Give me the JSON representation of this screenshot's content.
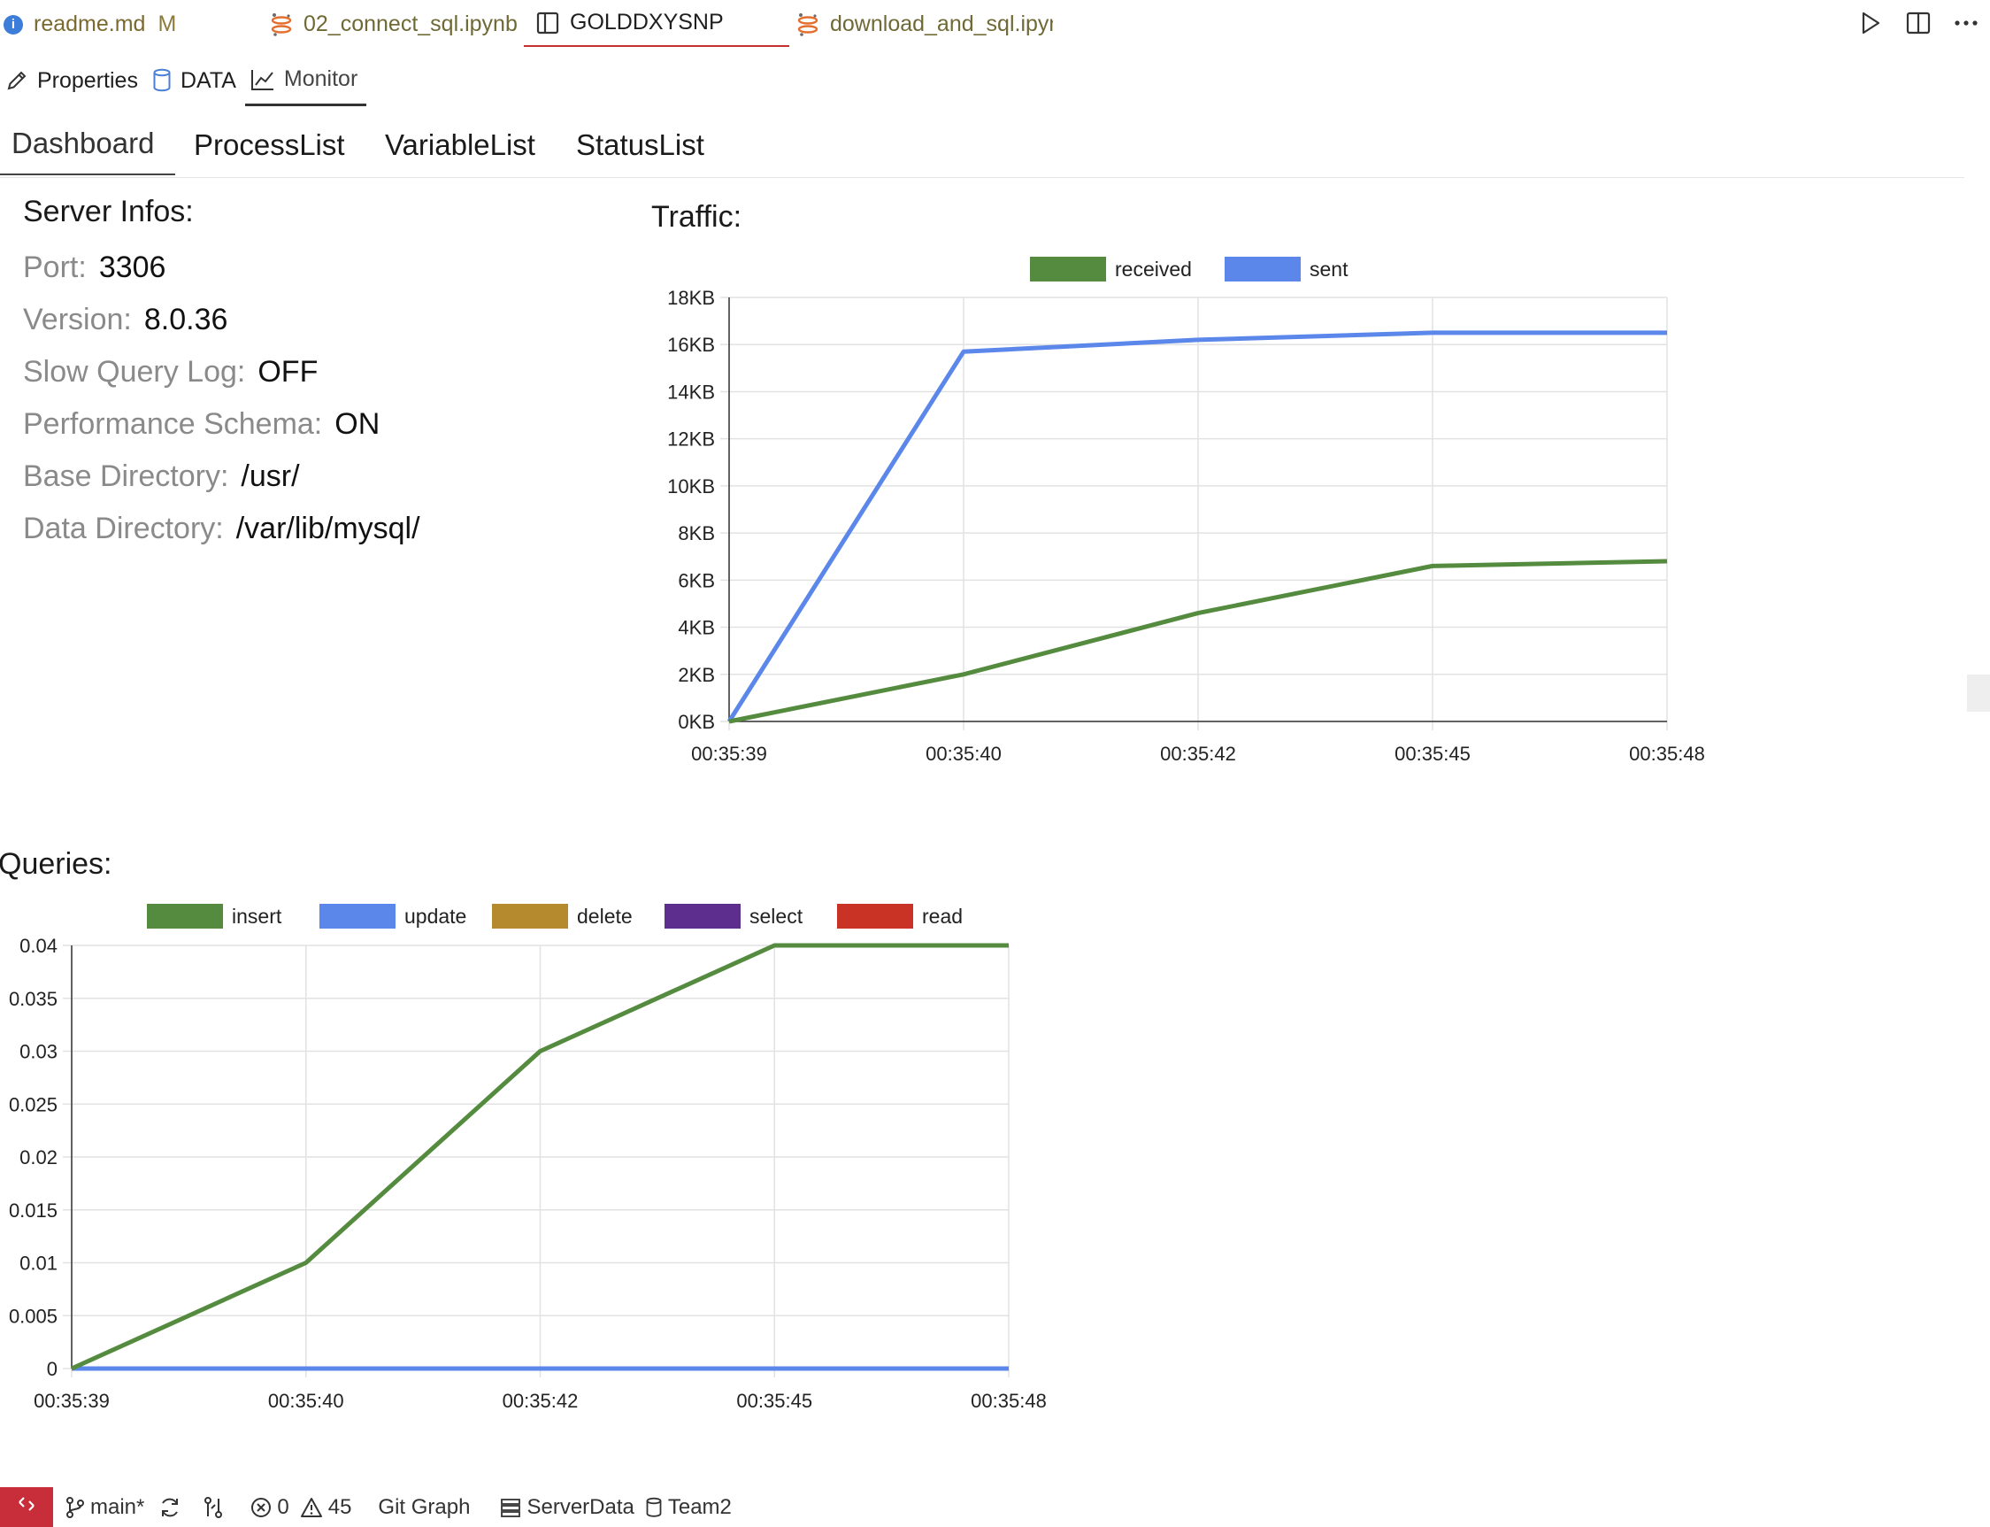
{
  "tabs": [
    {
      "label": "readme.md",
      "badge": "M"
    },
    {
      "label": "02_connect_sql.ipynb"
    },
    {
      "label": "GOLDDXYSNP"
    },
    {
      "label": "download_and_sql.ipynb"
    }
  ],
  "subtabs": [
    "Properties",
    "DATA",
    "Monitor"
  ],
  "nav": [
    "Dashboard",
    "ProcessList",
    "VariableList",
    "StatusList"
  ],
  "server": {
    "title": "Server Infos:",
    "rows": [
      {
        "key": "Port:",
        "value": "3306"
      },
      {
        "key": "Version:",
        "value": "8.0.36"
      },
      {
        "key": "Slow Query Log:",
        "value": "OFF"
      },
      {
        "key": "Performance Schema:",
        "value": "ON"
      },
      {
        "key": "Base Directory:",
        "value": "/usr/"
      },
      {
        "key": "Data Directory:",
        "value": "/var/lib/mysql/"
      }
    ]
  },
  "traffic_title": "Traffic:",
  "queries_title": "Queries:",
  "colors": {
    "received": "#548b3e",
    "sent": "#5b87ea",
    "insert": "#548b3e",
    "update": "#5b87ea",
    "delete": "#b58a2e",
    "select": "#5e2e8e",
    "read": "#c83326",
    "remote": "#c72e3a",
    "active_tab_border": "#c72e2e"
  },
  "status": {
    "branch": "main*",
    "errors": "0",
    "warnings": "45",
    "git_graph": "Git Graph",
    "server_data": "ServerData",
    "team": "Team2"
  },
  "chart_data": [
    {
      "type": "line",
      "x": [
        "00:35:39",
        "00:35:40",
        "00:35:42",
        "00:35:45",
        "00:35:48"
      ],
      "y_ticks": [
        "0KB",
        "2KB",
        "4KB",
        "6KB",
        "8KB",
        "10KB",
        "12KB",
        "14KB",
        "16KB",
        "18KB"
      ],
      "ylim": [
        0,
        18
      ],
      "grid": true,
      "legend": "top-center",
      "series": [
        {
          "name": "received",
          "values": [
            0,
            2.0,
            4.6,
            6.6,
            6.8
          ]
        },
        {
          "name": "sent",
          "values": [
            0,
            15.7,
            16.2,
            16.5,
            16.5
          ]
        }
      ]
    },
    {
      "type": "line",
      "x": [
        "00:35:39",
        "00:35:40",
        "00:35:42",
        "00:35:45",
        "00:35:48"
      ],
      "y_ticks": [
        "0",
        "0.005",
        "0.01",
        "0.015",
        "0.02",
        "0.025",
        "0.03",
        "0.035",
        "0.04"
      ],
      "ylim": [
        0,
        0.04
      ],
      "grid": true,
      "legend": "top-center",
      "series": [
        {
          "name": "insert",
          "values": [
            0,
            0.01,
            0.03,
            0.04,
            0.04
          ]
        },
        {
          "name": "update",
          "values": [
            0,
            0,
            0,
            0,
            0
          ]
        },
        {
          "name": "delete",
          "values": [
            0,
            0,
            0,
            0,
            0
          ]
        },
        {
          "name": "select",
          "values": [
            0,
            0,
            0,
            0,
            0
          ]
        },
        {
          "name": "read",
          "values": [
            0,
            0,
            0,
            0,
            0
          ]
        }
      ]
    }
  ]
}
